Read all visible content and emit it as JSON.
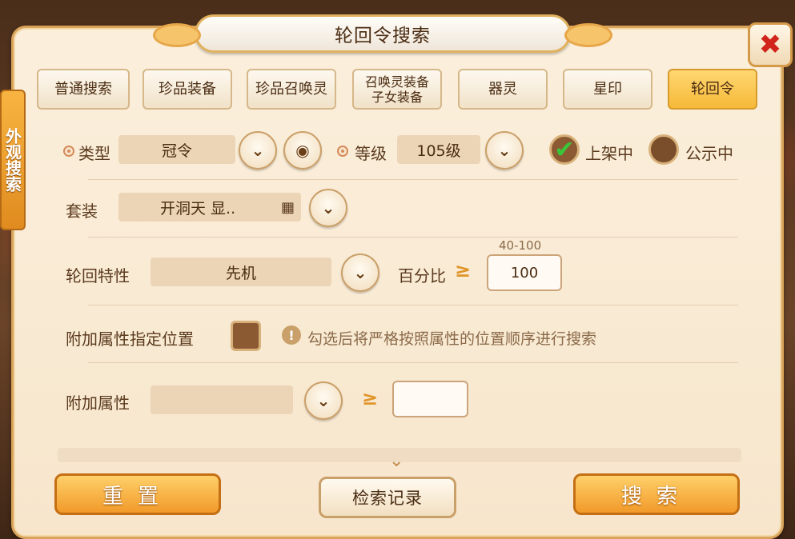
{
  "title": "轮回令搜索",
  "close_icon": "✖",
  "side_tab": "外观搜索",
  "tabs": [
    {
      "label": "普通搜索",
      "active": false
    },
    {
      "label": "珍品装备",
      "active": false
    },
    {
      "label": "珍品召唤灵",
      "active": false
    },
    {
      "label_line1": "召唤灵装备",
      "label_line2": "子女装备",
      "active": false
    },
    {
      "label": "器灵",
      "active": false
    },
    {
      "label": "星印",
      "active": false
    },
    {
      "label": "轮回令",
      "active": true
    }
  ],
  "row1": {
    "type_label": "类型",
    "type_value": "冠令",
    "level_label": "等级",
    "level_value": "105级",
    "on_shelf_label": "上架中",
    "on_shelf_checked": true,
    "public_label": "公示中",
    "public_checked": false
  },
  "row2": {
    "set_label": "套装",
    "set_value": "开洞天  显.."
  },
  "row3": {
    "trait_label": "轮回特性",
    "trait_value": "先机",
    "percent_label": "百分比",
    "ge_symbol": "≥",
    "range_hint": "40-100",
    "percent_value": "100"
  },
  "row4": {
    "pos_label": "附加属性指定位置",
    "info_icon": "!",
    "hint": "勾选后将严格按照属性的位置顺序进行搜索"
  },
  "row5": {
    "attr_label": "附加属性",
    "attr_value": "",
    "ge_symbol": "≥",
    "attr_input": ""
  },
  "buttons": {
    "reset": "重置",
    "history": "检索记录",
    "search": "搜索"
  },
  "icons": {
    "chevron": "⌄",
    "eye": "◉",
    "grid": "▦",
    "check": "✔"
  }
}
